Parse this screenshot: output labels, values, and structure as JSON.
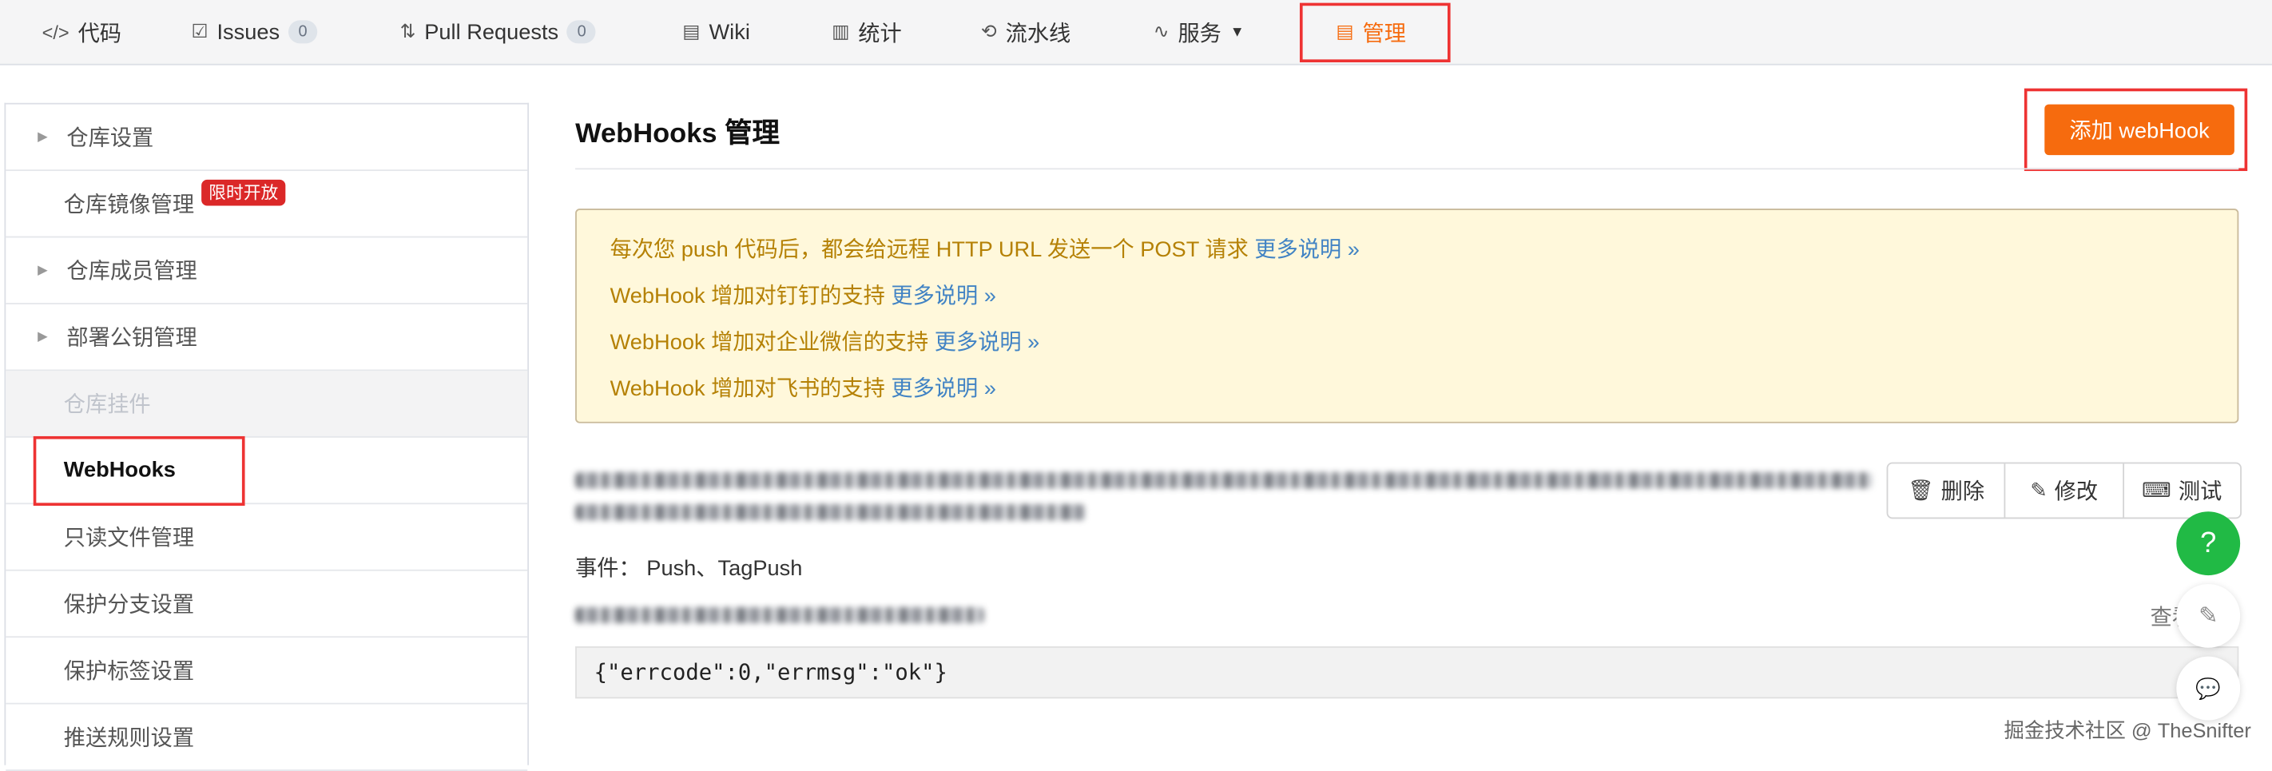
{
  "topnav": {
    "items": [
      {
        "icon": "code-icon",
        "glyph": "</>",
        "label": "代码"
      },
      {
        "icon": "issues-icon",
        "glyph": "☑",
        "label": "Issues",
        "count": "0"
      },
      {
        "icon": "pull-request-icon",
        "glyph": "⇅",
        "label": "Pull Requests",
        "count": "0"
      },
      {
        "icon": "wiki-icon",
        "glyph": "▤",
        "label": "Wiki"
      },
      {
        "icon": "stats-icon",
        "glyph": "▥",
        "label": "统计"
      },
      {
        "icon": "pipeline-icon",
        "glyph": "⟲",
        "label": "流水线"
      },
      {
        "icon": "services-icon",
        "glyph": "∿",
        "label": "服务"
      },
      {
        "icon": "manage-icon",
        "glyph": "▤",
        "label": "管理"
      }
    ]
  },
  "sidebar": {
    "items": [
      {
        "label": "仓库设置"
      },
      {
        "label": "仓库镜像管理",
        "badge": "限时开放"
      },
      {
        "label": "仓库成员管理"
      },
      {
        "label": "部署公钥管理"
      },
      {
        "label": "仓库挂件"
      },
      {
        "label": "WebHooks"
      },
      {
        "label": "只读文件管理"
      },
      {
        "label": "保护分支设置"
      },
      {
        "label": "保护标签设置"
      },
      {
        "label": "推送规则设置"
      }
    ]
  },
  "main": {
    "title": "WebHooks 管理",
    "add_button": "添加 webHook",
    "notice": [
      {
        "text": "每次您 push 代码后，都会给远程 HTTP URL 发送一个 POST 请求",
        "more": "更多说明 »"
      },
      {
        "text": "WebHook 增加对钉钉的支持",
        "more": "更多说明 »"
      },
      {
        "text": "WebHook 增加对企业微信的支持",
        "more": "更多说明 »"
      },
      {
        "text": "WebHook 增加对飞书的支持",
        "more": "更多说明 »"
      }
    ],
    "hook": {
      "events_label": "事件：",
      "events_value": "Push、TagPush",
      "actions": {
        "delete": "删除",
        "edit": "修改",
        "test": "测试"
      },
      "view_link": "查看",
      "response": "{\"errcode\":0,\"errmsg\":\"ok\"}"
    }
  },
  "float_buttons": {
    "help": "?"
  },
  "watermark": "掘金技术社区 @ TheSnifter",
  "colors": {
    "accent": "#f66b0e",
    "notice_bg": "#fff8db",
    "notice_text": "#b58105",
    "link": "#4183c4",
    "highlight_box": "#ee3333",
    "badge": "#db2828",
    "help": "#21ba45"
  }
}
